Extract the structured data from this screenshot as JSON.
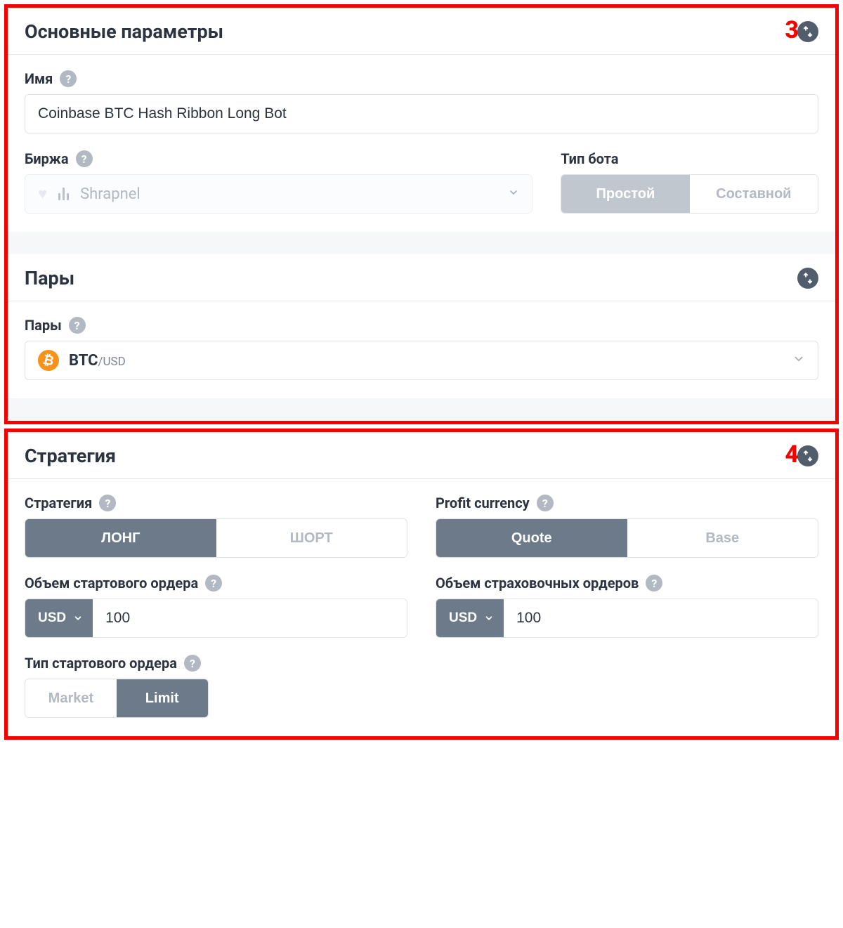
{
  "annotations": {
    "box3": "3",
    "box4": "4"
  },
  "basic": {
    "title": "Основные параметры",
    "name_label": "Имя",
    "name_value": "Coinbase BTC Hash Ribbon Long Bot",
    "exchange_label": "Биржа",
    "exchange_value": "Shrapnel",
    "bot_type_label": "Тип бота",
    "bot_type_simple": "Простой",
    "bot_type_compound": "Составной"
  },
  "pairs": {
    "title": "Пары",
    "label": "Пары",
    "pair_base": "BTC",
    "pair_quote": "/USD",
    "pair_icon_glyph": "₿"
  },
  "strategy": {
    "title": "Стратегия",
    "strategy_label": "Стратегия",
    "long": "ЛОНГ",
    "short": "ШОРТ",
    "profit_currency_label": "Profit currency",
    "quote": "Quote",
    "base": "Base",
    "start_order_volume_label": "Объем стартового ордера",
    "safety_order_volume_label": "Объем страховочных ордеров",
    "currency": "USD",
    "start_volume_value": "100",
    "safety_volume_value": "100",
    "start_order_type_label": "Тип стартового ордера",
    "market": "Market",
    "limit": "Limit"
  }
}
